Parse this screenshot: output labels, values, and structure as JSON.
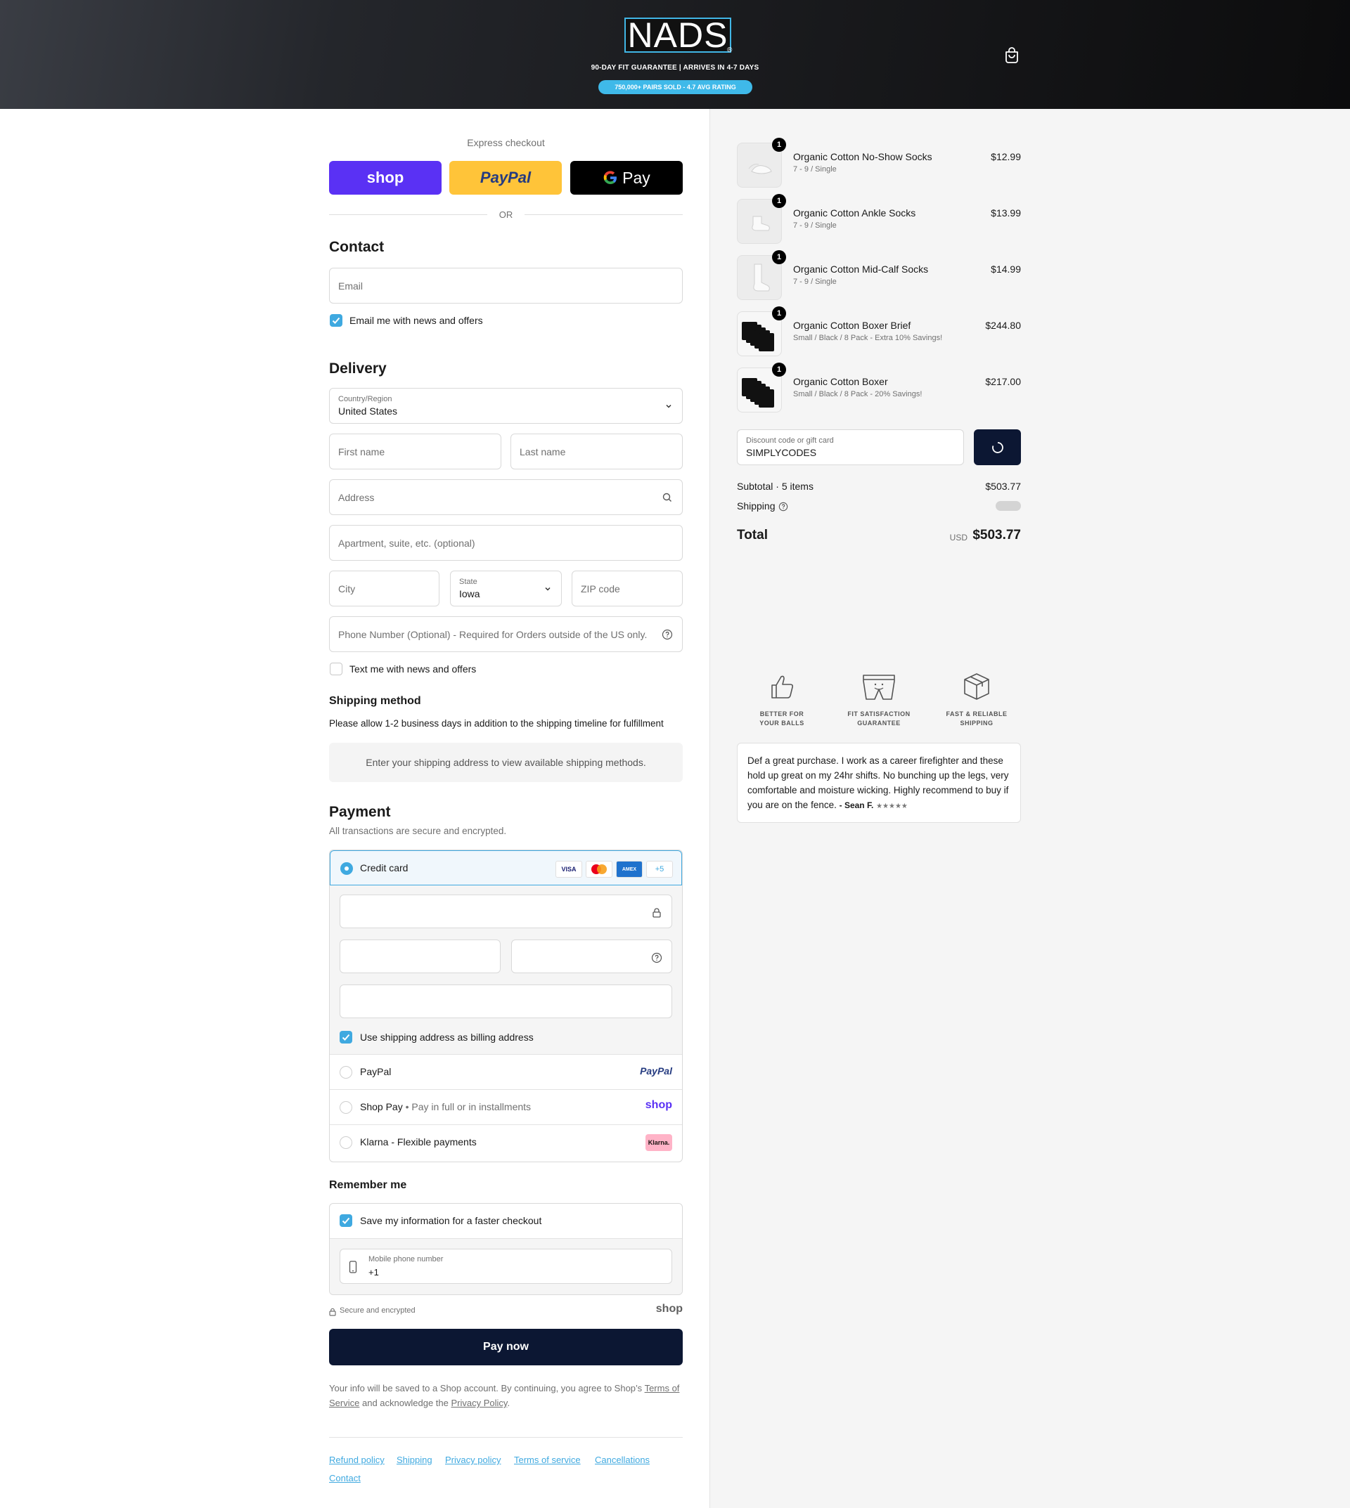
{
  "header": {
    "logo": "NADS",
    "logo_mark": "®",
    "tagline": "90-DAY FIT GUARANTEE | ARRIVES IN 4-7 DAYS",
    "pill": "750,000+ PAIRS SOLD - 4.7 AVG RATING",
    "cart_icon": "shopping-bag-icon"
  },
  "express": {
    "label": "Express checkout",
    "shop": "shop",
    "paypal": "PayPal",
    "gpay": "Pay",
    "or": "OR"
  },
  "contact": {
    "title": "Contact",
    "email_placeholder": "Email",
    "news_label": "Email me with news and offers"
  },
  "delivery": {
    "title": "Delivery",
    "country_label": "Country/Region",
    "country_value": "United States",
    "first_name": "First name",
    "last_name": "Last name",
    "address": "Address",
    "apartment": "Apartment, suite, etc. (optional)",
    "city": "City",
    "state_label": "State",
    "state_value": "Iowa",
    "zip": "ZIP code",
    "phone": "Phone Number (Optional) - Required for Orders outside of the US only.",
    "text_label": "Text me with news and offers"
  },
  "shipping": {
    "title": "Shipping method",
    "note": "Please allow 1-2 business days in addition to the shipping timeline for fulfillment",
    "placeholder": "Enter your shipping address to view available shipping methods."
  },
  "payment": {
    "title": "Payment",
    "subtitle": "All transactions are secure and encrypted.",
    "credit_card": "Credit card",
    "card_logos": [
      "VISA",
      "",
      "AMEX",
      "+5"
    ],
    "billing_label": "Use shipping address as billing address",
    "paypal": "PayPal",
    "paypal_logo": "PayPal",
    "shop_pay": "Shop Pay",
    "shop_pay_sub": "Pay in full or in installments",
    "shop_logo": "shop",
    "klarna": "Klarna - Flexible payments",
    "klarna_logo": "Klarna."
  },
  "remember": {
    "title": "Remember me",
    "save_label": "Save my information for a faster checkout",
    "phone_label": "Mobile phone number",
    "phone_value": "+1",
    "secure": "Secure and encrypted",
    "shop_logo": "shop"
  },
  "pay_button": "Pay now",
  "legal": {
    "text1": "Your info will be saved to a Shop account. By continuing, you agree to Shop’s",
    "tos": "Terms of Service",
    "text2": "and acknowledge the",
    "privacy": "Privacy Policy",
    "end": "."
  },
  "footer_links": [
    "Refund policy",
    "Shipping",
    "Privacy policy",
    "Terms of service",
    "Cancellations",
    "Contact"
  ],
  "order": {
    "items": [
      {
        "qty": "1",
        "name": "Organic Cotton No-Show Socks",
        "variant": "7 - 9 / Single",
        "price": "$12.99"
      },
      {
        "qty": "1",
        "name": "Organic Cotton Ankle Socks",
        "variant": "7 - 9 / Single",
        "price": "$13.99"
      },
      {
        "qty": "1",
        "name": "Organic Cotton Mid-Calf Socks",
        "variant": "7 - 9 / Single",
        "price": "$14.99"
      },
      {
        "qty": "1",
        "name": "Organic Cotton Boxer Brief",
        "variant": "Small / Black / 8 Pack - Extra 10% Savings!",
        "price": "$244.80"
      },
      {
        "qty": "1",
        "name": "Organic Cotton Boxer",
        "variant": "Small / Black / 8 Pack - 20% Savings!",
        "price": "$217.00"
      }
    ],
    "discount_label": "Discount code or gift card",
    "discount_value": "SIMPLYCODES",
    "subtotal_label": "Subtotal · 5 items",
    "subtotal_value": "$503.77",
    "shipping_label": "Shipping",
    "total_label": "Total",
    "currency": "USD",
    "total_value": "$503.77"
  },
  "perks": [
    {
      "icon": "thumbs-up-icon",
      "label1": "BETTER FOR",
      "label2": "YOUR BALLS"
    },
    {
      "icon": "boxers-icon",
      "label1": "FIT SATISFACTION",
      "label2": "GUARANTEE"
    },
    {
      "icon": "box-icon",
      "label1": "FAST & RELIABLE",
      "label2": "SHIPPING"
    }
  ],
  "review": {
    "text": "Def a great purchase. I work as a career firefighter and these hold up great on my 24hr shifts. No bunching up the legs, very comfortable and moisture wicking. Highly recommend to buy if you are on the fence.",
    "author": "- Sean F.",
    "stars": "★★★★★"
  },
  "colors": {
    "accent": "#3fa9e0",
    "dark_button": "#0c1733",
    "shop_purple": "#5a31f4",
    "paypal_yellow": "#ffc439"
  }
}
